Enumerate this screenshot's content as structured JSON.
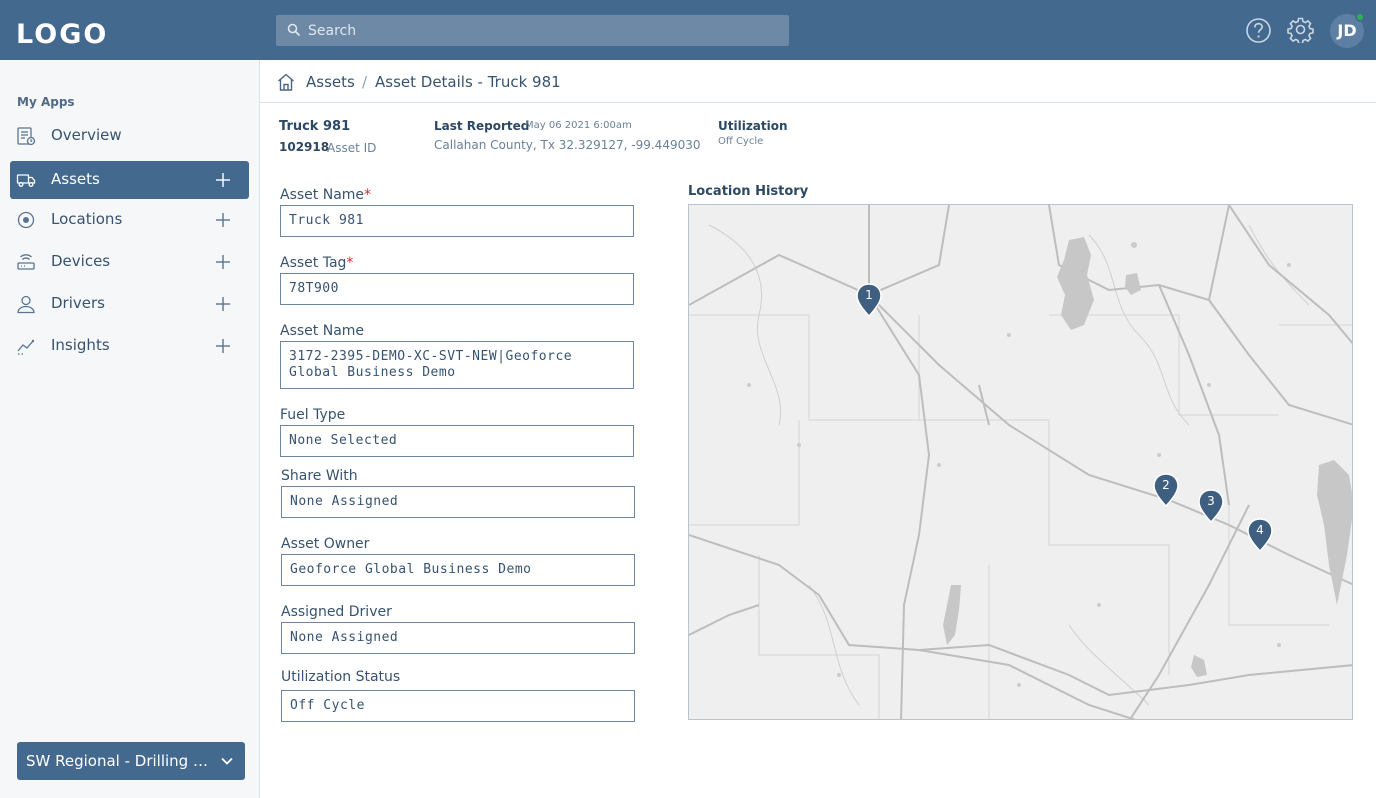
{
  "header": {
    "logo": "LOGO",
    "search_placeholder": "Search",
    "avatar_initials": "JD"
  },
  "sidebar": {
    "section_label": "My Apps",
    "items": [
      {
        "label": "Overview",
        "icon": "overview-icon",
        "active": false,
        "has_add": false
      },
      {
        "label": "Assets",
        "icon": "truck-icon",
        "active": true,
        "has_add": true
      },
      {
        "label": "Locations",
        "icon": "location-icon",
        "active": false,
        "has_add": true
      },
      {
        "label": "Devices",
        "icon": "device-icon",
        "active": false,
        "has_add": true
      },
      {
        "label": "Drivers",
        "icon": "user-icon",
        "active": false,
        "has_add": true
      },
      {
        "label": "Insights",
        "icon": "chart-line-icon",
        "active": false,
        "has_add": true
      }
    ],
    "org_select": "SW Regional - Drilling Operations"
  },
  "breadcrumb": {
    "parent": "Assets",
    "separator": "/",
    "current": "Asset Details - Truck 981"
  },
  "summary": {
    "name": "Truck 981",
    "asset_id": "102918",
    "asset_id_label": "Asset ID",
    "last_reported_label": "Last Reported",
    "last_reported_date": "May 06 2021 6:00am",
    "location": "Callahan County, Tx 32.329127, -99.449030",
    "utilization_label": "Utilization",
    "utilization_value": "Off Cycle"
  },
  "form": {
    "asset_name": {
      "label": "Asset Name",
      "required": "*",
      "value": "Truck 981"
    },
    "asset_tag": {
      "label": "Asset Tag",
      "required": "*",
      "value": "78T900"
    },
    "asset_name_full": {
      "label": "Asset Name",
      "value": "3172-2395-DEMO-XC-SVT-NEW|Geoforce Global Business Demo"
    },
    "fuel_type": {
      "label": "Fuel Type",
      "value": "None Selected"
    },
    "share_with": {
      "label": "Share With",
      "value": "None Assigned"
    },
    "asset_owner": {
      "label": "Asset Owner",
      "value": "Geoforce Global Business Demo"
    },
    "assigned_driver": {
      "label": "Assigned Driver",
      "value": "None Assigned"
    },
    "utilization_status": {
      "label": "Utilization Status",
      "value": "Off Cycle"
    }
  },
  "map": {
    "title": "Location History",
    "pins": [
      "1",
      "2",
      "3",
      "4"
    ],
    "pin_color": "#3e5f80"
  },
  "colors": {
    "header_bg": "#44698f",
    "accent": "#44698f",
    "online_dot": "#2bb24c",
    "required": "#d0312d"
  }
}
